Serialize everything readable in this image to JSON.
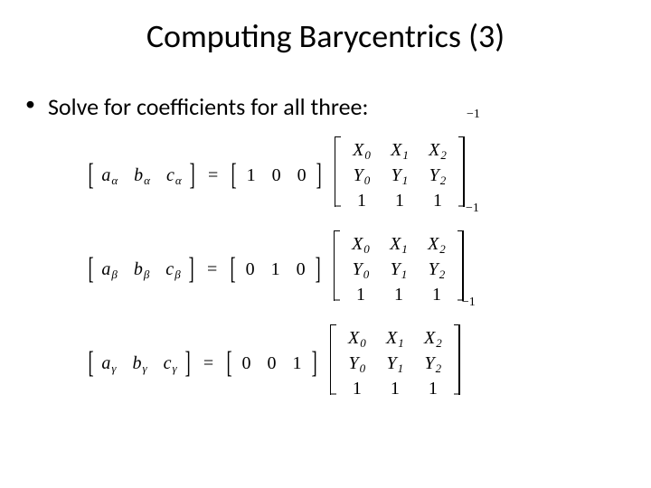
{
  "title": "Computing Barycentrics (3)",
  "bullet": "Solve for coefficients for all three:",
  "equations": [
    {
      "lhs": [
        "a",
        "b",
        "c"
      ],
      "sub": "α",
      "rhs": [
        "1",
        "0",
        "0"
      ]
    },
    {
      "lhs": [
        "a",
        "b",
        "c"
      ],
      "sub": "β",
      "rhs": [
        "0",
        "1",
        "0"
      ]
    },
    {
      "lhs": [
        "a",
        "b",
        "c"
      ],
      "sub": "γ",
      "rhs": [
        "0",
        "0",
        "1"
      ]
    }
  ],
  "matrix": {
    "rows": [
      [
        [
          "X",
          "0"
        ],
        [
          "X",
          "1"
        ],
        [
          "X",
          "2"
        ]
      ],
      [
        [
          "Y",
          "0"
        ],
        [
          "Y",
          "1"
        ],
        [
          "Y",
          "2"
        ]
      ],
      [
        [
          "1",
          ""
        ],
        [
          "1",
          ""
        ],
        [
          "1",
          ""
        ]
      ]
    ],
    "exponent": "−1"
  },
  "eq_sign": "="
}
